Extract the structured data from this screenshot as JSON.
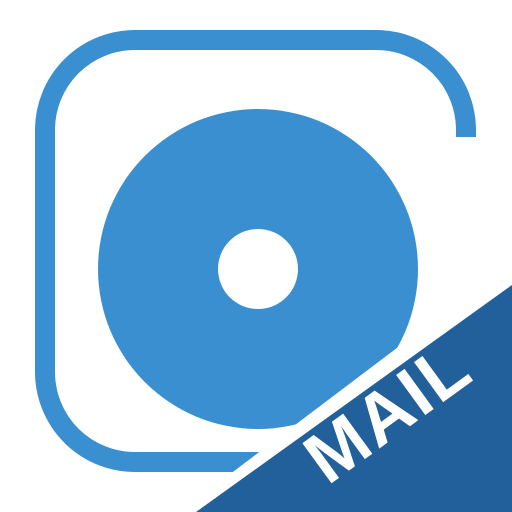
{
  "app_icon": {
    "icon_name": "mail-app-icon",
    "ribbon_label": "MAIL",
    "colors": {
      "background": "#ffffff",
      "primary_blue": "#3a8fd0",
      "ribbon_blue": "#22609c",
      "ribbon_text": "#ffffff",
      "center_hole": "#ffffff"
    }
  }
}
